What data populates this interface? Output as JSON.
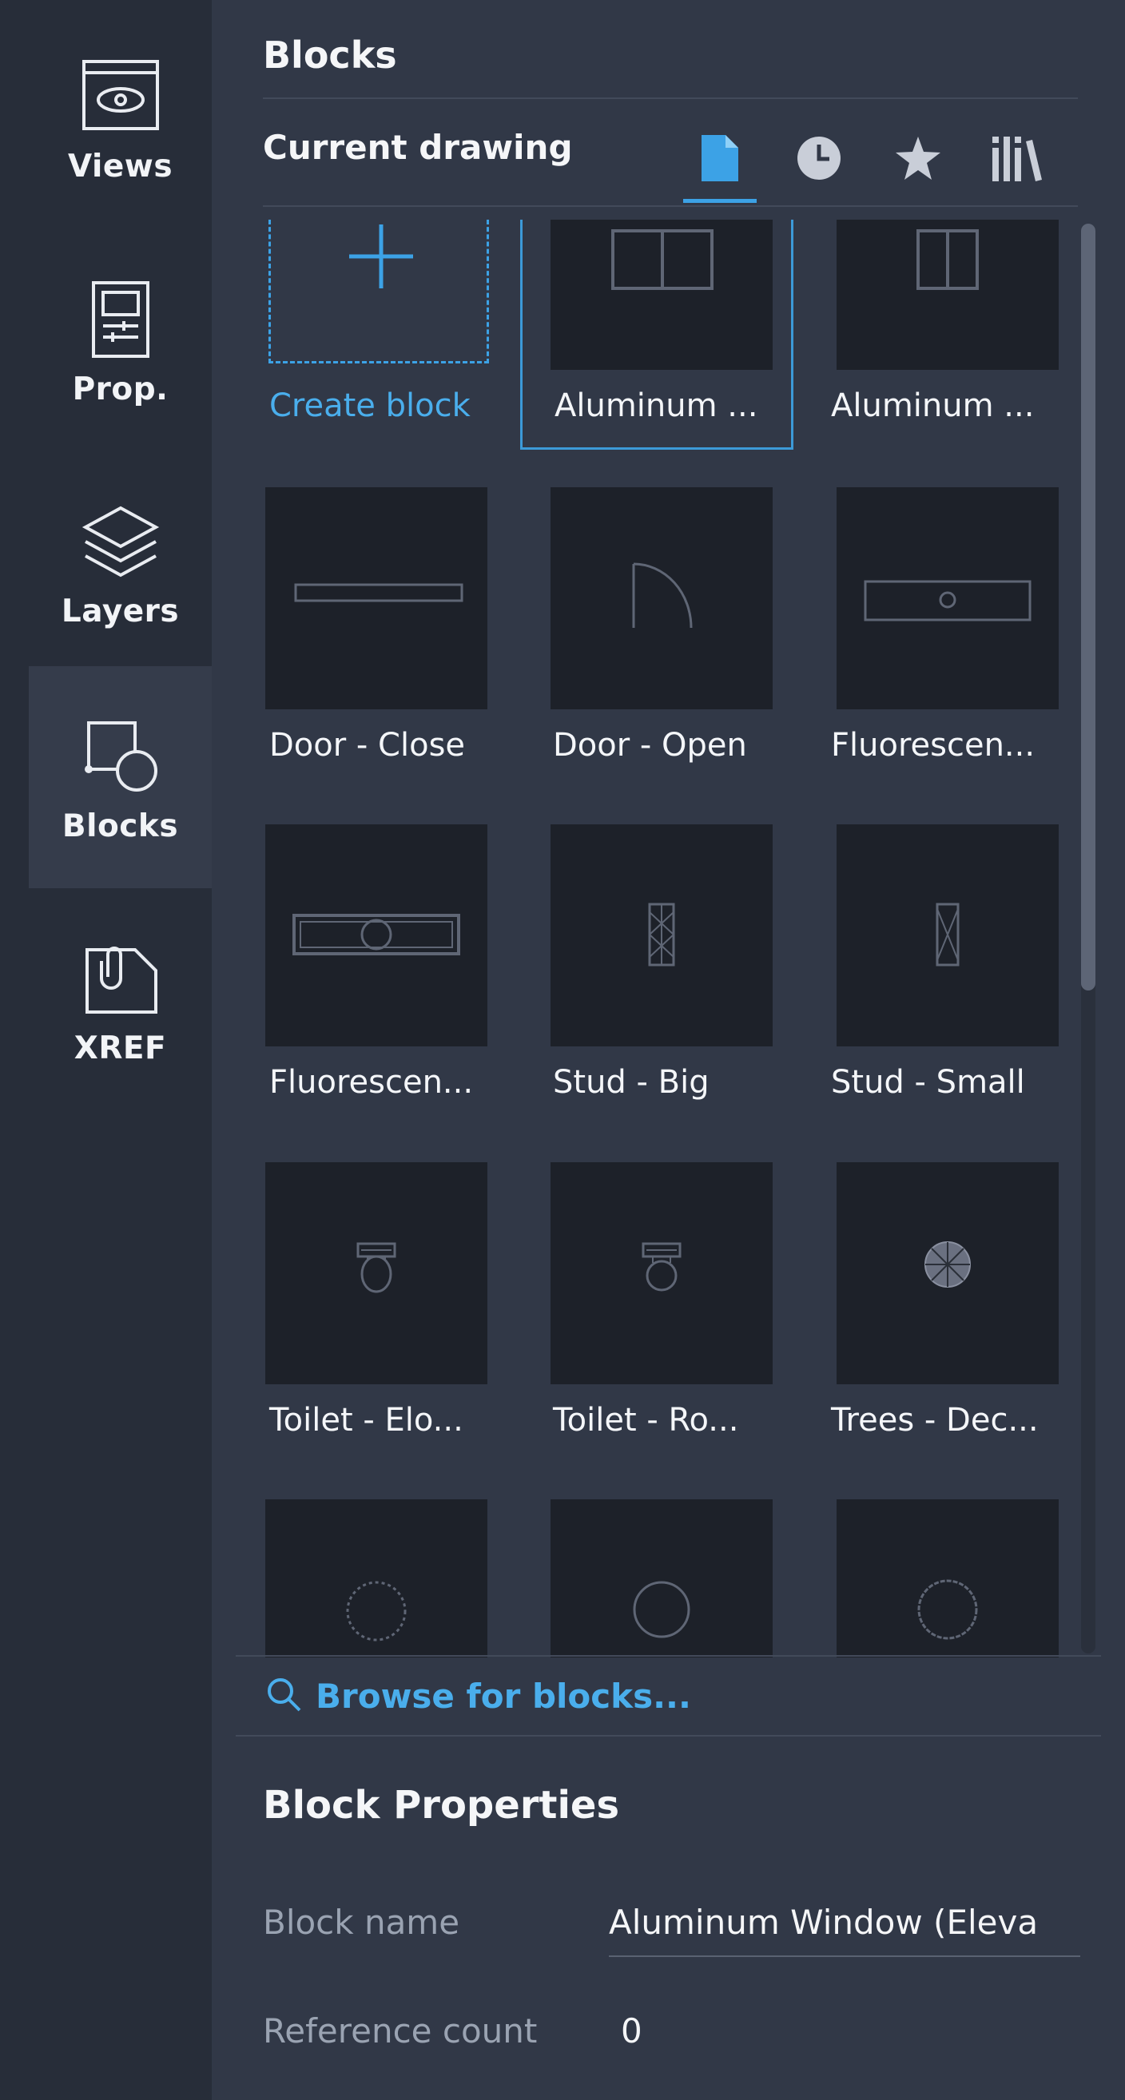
{
  "rail": {
    "items": [
      {
        "label": "Views",
        "icon": "eye-icon"
      },
      {
        "label": "Prop.",
        "icon": "properties-icon"
      },
      {
        "label": "Layers",
        "icon": "layers-icon"
      },
      {
        "label": "Blocks",
        "icon": "blocks-icon",
        "active": true
      },
      {
        "label": "XREF",
        "icon": "xref-icon"
      }
    ]
  },
  "panel": {
    "title": "Blocks",
    "section_label": "Current drawing",
    "tabs": [
      {
        "name": "current-drawing",
        "icon": "document-icon",
        "active": true
      },
      {
        "name": "recent",
        "icon": "clock-icon"
      },
      {
        "name": "favorites",
        "icon": "star-icon"
      },
      {
        "name": "libraries",
        "icon": "library-icon"
      }
    ]
  },
  "blocks": {
    "create_label": "Create block",
    "items": [
      "Aluminum ...",
      "Aluminum ...",
      "Door - Close",
      "Door - Open",
      "Fluorescen...",
      "Fluorescen...",
      "Stud - Big",
      "Stud - Small",
      "Toilet - Elo...",
      "Toilet - Ro...",
      "Trees - Dec...",
      "",
      "",
      ""
    ],
    "selected_index": 0
  },
  "browse": {
    "label": "Browse for blocks..."
  },
  "properties": {
    "title": "Block Properties",
    "block_name_label": "Block name",
    "block_name_value": "Aluminum Window (Eleva",
    "reference_count_label": "Reference count",
    "reference_count_value": "0"
  },
  "colors": {
    "accent": "#3ca2e6",
    "rail_bg": "#272d39",
    "panel_bg": "#313847",
    "thumb_bg": "#1d2129"
  }
}
